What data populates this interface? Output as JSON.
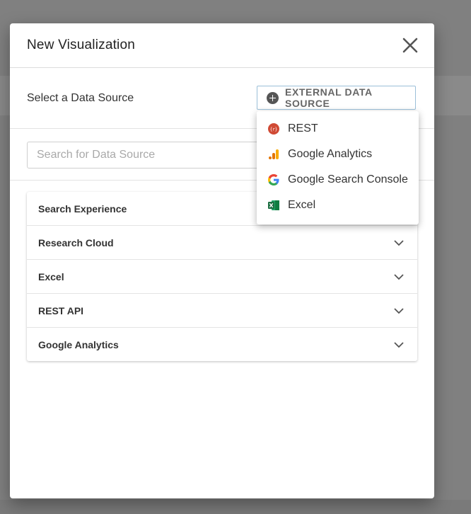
{
  "modal": {
    "title": "New Visualization"
  },
  "source_row": {
    "label": "Select a Data Source",
    "external_button_label": "EXTERNAL DATA SOURCE"
  },
  "search": {
    "placeholder": "Search for Data Source",
    "value": ""
  },
  "accordion": {
    "items": [
      {
        "label": "Search Experience"
      },
      {
        "label": "Research Cloud"
      },
      {
        "label": "Excel"
      },
      {
        "label": "REST API"
      },
      {
        "label": "Google Analytics"
      }
    ]
  },
  "dropdown": {
    "items": [
      {
        "label": "REST",
        "icon": "rest-icon"
      },
      {
        "label": "Google Analytics",
        "icon": "google-analytics-icon"
      },
      {
        "label": "Google Search Console",
        "icon": "google-icon"
      },
      {
        "label": "Excel",
        "icon": "excel-icon"
      }
    ]
  },
  "colors": {
    "rest_red": "#d04a35",
    "analytics_orange": "#f9ab00",
    "analytics_dark": "#e37400",
    "excel_green": "#1d6f42",
    "button_border": "#9bbfd8"
  }
}
